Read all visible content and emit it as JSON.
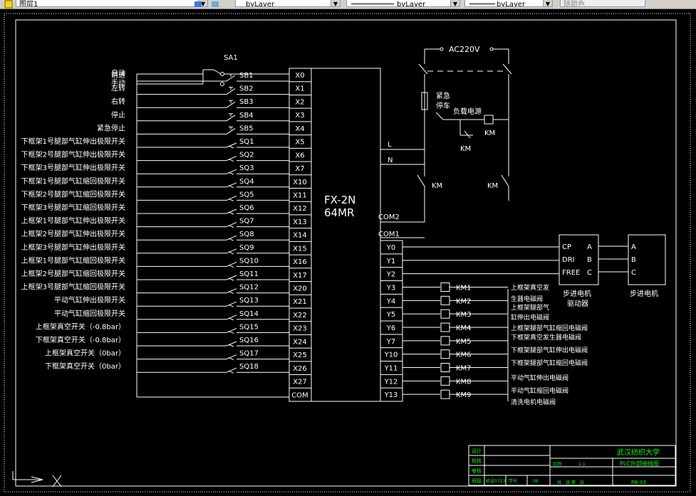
{
  "toolbar": {
    "layer_name": "图层1",
    "color_value": "byLayer",
    "linetype_value": "byLayer",
    "lineweight_value": "byLayer",
    "plotstyle_value": "随颜色"
  },
  "inputs": [
    {
      "label": "自动",
      "contact": "SA1",
      "terminal": "X0"
    },
    {
      "label": "手动",
      "contact": "",
      "terminal": ""
    },
    {
      "label": "前进",
      "contact": "SB1",
      "terminal": "X1"
    },
    {
      "label": "左转",
      "contact": "SB2",
      "terminal": "X2"
    },
    {
      "label": "右转",
      "contact": "SB3",
      "terminal": "X3"
    },
    {
      "label": "停止",
      "contact": "SB4",
      "terminal": "X4"
    },
    {
      "label": "紧急停止",
      "contact": "SB5",
      "terminal": "X5"
    },
    {
      "label": "下框架1号腿部气缸伸出极限开关",
      "contact": "SQ1",
      "terminal": "X6"
    },
    {
      "label": "下框架2号腿部气缸伸出极限开关",
      "contact": "SQ2",
      "terminal": "X7"
    },
    {
      "label": "下框架3号腿部气缸伸出极限开关",
      "contact": "SQ3",
      "terminal": "X10"
    },
    {
      "label": "下框架1号腿部气缸缩回极限开关",
      "contact": "SQ4",
      "terminal": "X11"
    },
    {
      "label": "下框架2号腿部气缸缩回极限开关",
      "contact": "SQ5",
      "terminal": "X12"
    },
    {
      "label": "下框架3号腿部气缸缩回极限开关",
      "contact": "SQ6",
      "terminal": "X13"
    },
    {
      "label": "上框架1号腿部气缸伸出极限开关",
      "contact": "SQ7",
      "terminal": "X14"
    },
    {
      "label": "上框架2号腿部气缸伸出极限开关",
      "contact": "SQ8",
      "terminal": "X15"
    },
    {
      "label": "上框架3号腿部气缸伸出极限开关",
      "contact": "SQ9",
      "terminal": "X16"
    },
    {
      "label": "上框架1号腿部气缸缩回极限开关",
      "contact": "SQ10",
      "terminal": "X17"
    },
    {
      "label": "上框架2号腿部气缸缩回极限开关",
      "contact": "SQ11",
      "terminal": "X20"
    },
    {
      "label": "上框架3号腿部气缸缩回极限开关",
      "contact": "SQ12",
      "terminal": "X21"
    },
    {
      "label": "平动气缸伸出极限开关",
      "contact": "SQ13",
      "terminal": "X22"
    },
    {
      "label": "平动气缸缩回极限开关",
      "contact": "SQ14",
      "terminal": "X23"
    },
    {
      "label": "上框架真空开关（-0.8bar）",
      "contact": "SQ15",
      "terminal": "X24"
    },
    {
      "label": "下框架真空开关（-0.8bar）",
      "contact": "SQ16",
      "terminal": "X25"
    },
    {
      "label": "上框架真空开关（0bar）",
      "contact": "SQ17",
      "terminal": "X26"
    },
    {
      "label": "下框架真空开关（0bar）",
      "contact": "SQ18",
      "terminal": "X27"
    }
  ],
  "input_com": "COM",
  "plc": {
    "model_line1": "FX-2N",
    "model_line2": "64MR",
    "L": "L",
    "N": "N",
    "com2": "COM2",
    "com1": "COM1"
  },
  "outputs": [
    "Y0",
    "Y1",
    "Y2",
    "Y3",
    "Y4",
    "Y5",
    "Y6",
    "Y7",
    "Y10",
    "Y11",
    "Y12",
    "Y13"
  ],
  "relays": [
    {
      "name": "KM1",
      "desc": "上框架真空发"
    },
    {
      "name": "KM2",
      "desc": "生器电磁阀"
    },
    {
      "name": "KM3",
      "desc": "上框架腿部气"
    },
    {
      "name": "KM4",
      "desc": "缸伸出电磁阀"
    },
    {
      "name": "KM5",
      "desc": "上框架腿部气缸缩回电磁阀"
    },
    {
      "name": "KM6",
      "desc": "下框架真空发生器电磁阀"
    },
    {
      "name": "KM7",
      "desc": "下框架腿部气缸伸出电磁阀"
    },
    {
      "name": "KM8",
      "desc": "下框架腿部气缸缩回电磁阀"
    },
    {
      "name": "KM9",
      "desc": "平动气缸伸出电磁阀"
    }
  ],
  "relay_extra_desc": [
    "平动气缸缩回电磁阀",
    "清洗电机电磁阀"
  ],
  "power": {
    "ac_label": "AC220V",
    "estop_label1": "紧急",
    "estop_label2": "停车",
    "load_label": "负载电源",
    "km_labels": [
      "KM",
      "KM",
      "KM",
      "KM"
    ]
  },
  "driver": {
    "pins": [
      "CP",
      "DRI",
      "FREE"
    ],
    "outs": [
      "A",
      "B",
      "C"
    ],
    "caption1": "步进电机",
    "caption2": "驱动器"
  },
  "motor": {
    "pins": [
      "A",
      "B",
      "C"
    ],
    "caption": "步进电机"
  },
  "title_block": {
    "labels": [
      "设计",
      "校核",
      "审核",
      "班级"
    ],
    "class_value": "机设0723",
    "number_label": "学号",
    "number_value": "06",
    "school": "武汉纺织大学",
    "drawing_title": "PLC外部接线图",
    "ratio_label": "比例",
    "ratio_value": "1:1",
    "sheet_text": "共　张 第　张",
    "drawing_no": "RB-03"
  },
  "colors": {
    "line": "#ffffff",
    "title_block": "#00ff00",
    "background": "#000000"
  }
}
